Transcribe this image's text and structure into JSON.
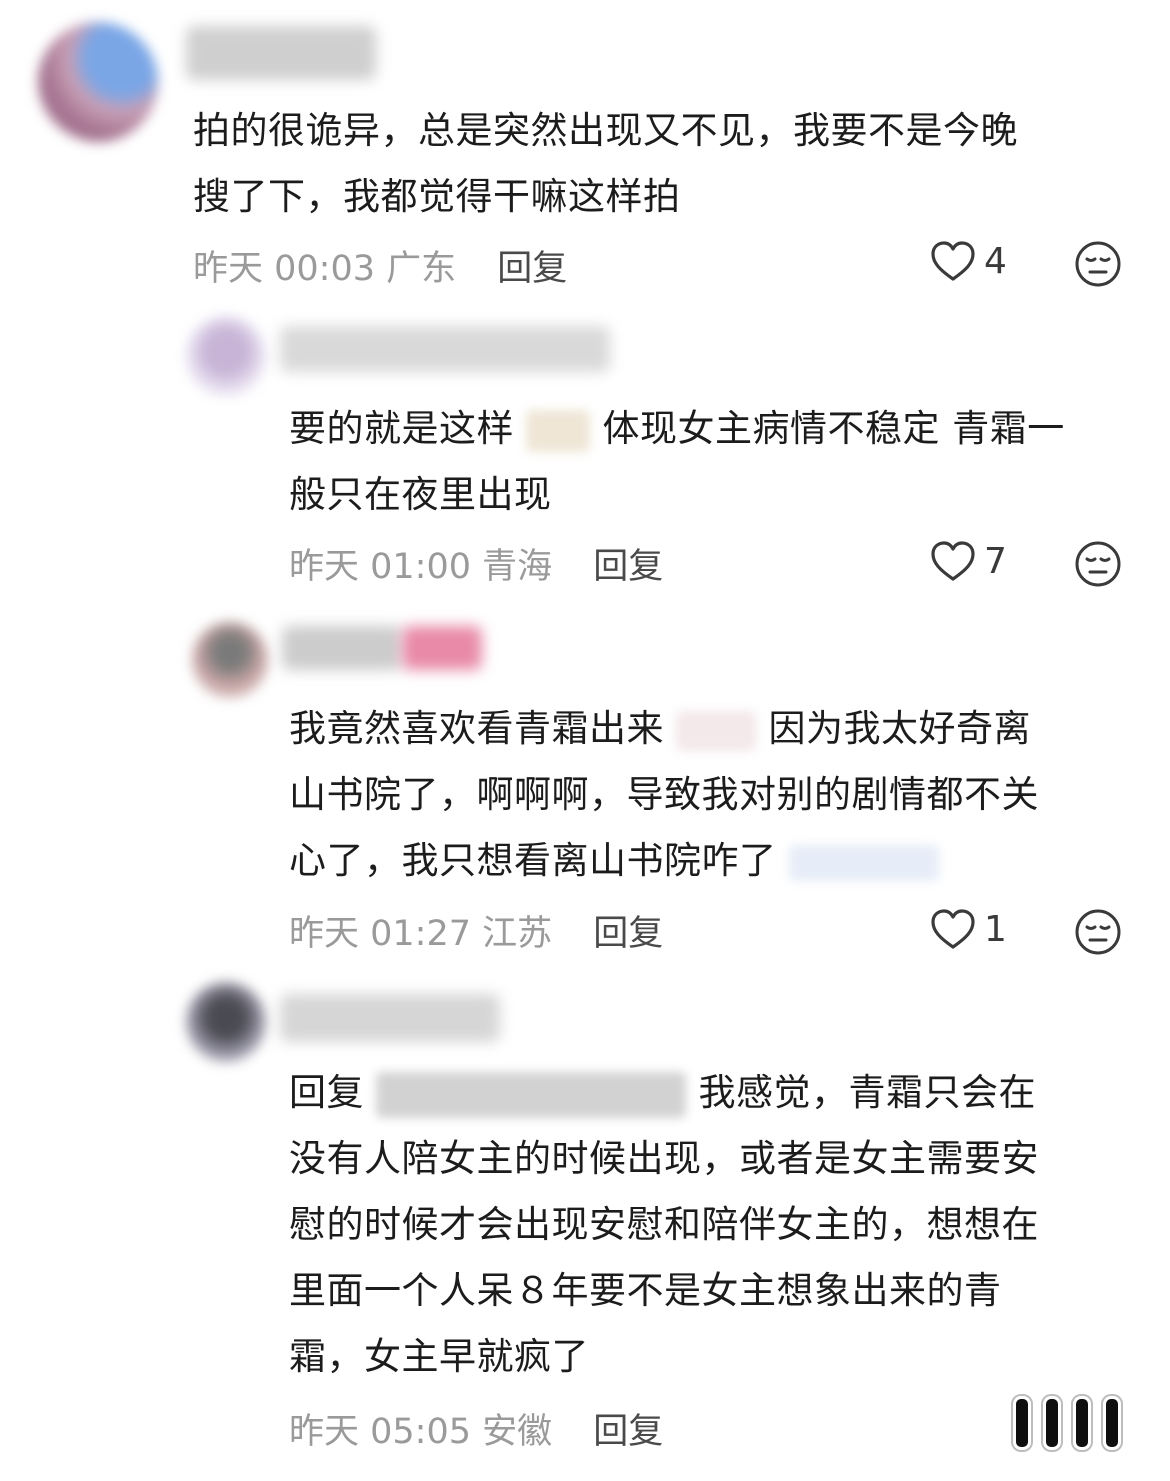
{
  "comments": [
    {
      "text_lines": [
        "拍的很诡异，总是突然出现又不见，我要不是今晚",
        "搜了下，我都觉得干嘛这样拍"
      ],
      "time": "昨天 00:03",
      "location": "广东",
      "reply_label": "回复",
      "likes": "4"
    },
    {
      "text_lines_a": [
        "要的就是这样",
        "体现女主病情不稳定 青霜一"
      ],
      "text_line_b": "般只在夜里出现",
      "time": "昨天 01:00",
      "location": "青海",
      "reply_label": "回复",
      "likes": "7"
    },
    {
      "line1_a": "我竟然喜欢看青霜出来",
      "line1_b": "因为我太好奇离",
      "line2": "山书院了，啊啊啊，导致我对别的剧情都不关",
      "line3": "心了，我只想看离山书院咋了",
      "time": "昨天 01:27",
      "location": "江苏",
      "reply_label": "回复",
      "likes": "1"
    },
    {
      "line1_a": "回复",
      "line1_b": "我感觉，青霜只会在",
      "line2": "没有人陪女主的时候出现，或者是女主需要安",
      "line3": "慰的时候才会出现安慰和陪伴女主的，想想在",
      "line4": "里面一个人呆８年要不是女主想象出来的青",
      "line5": "霜，女主早就疯了",
      "time": "昨天 05:05",
      "location": "安徽",
      "reply_label": "回复"
    }
  ],
  "icons": {
    "like": "heart-outline-icon",
    "dislike": "meh-face-icon"
  }
}
